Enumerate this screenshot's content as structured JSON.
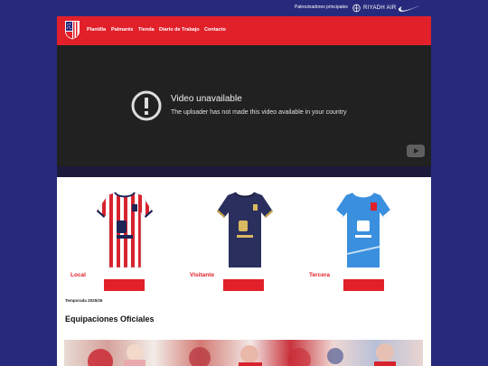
{
  "sponsors": {
    "label": "Patrocinadores principales",
    "riyadh_air": "RIYADH AIR",
    "icons": [
      "riyadh-air-logo",
      "nike-swoosh"
    ]
  },
  "nav": {
    "items": [
      "Plantilla",
      "Palmarés",
      "Tienda",
      "Diario de Trabajo",
      "Contacto"
    ]
  },
  "video": {
    "title": "Video unavailable",
    "message": "The uploader has not made this video available in your country"
  },
  "kits": [
    {
      "label": "Local"
    },
    {
      "label": "Visitante"
    },
    {
      "label": "Tercera"
    }
  ],
  "season": "Temporada 2025/26",
  "section_title": "Equipaciones Oficiales",
  "colors": {
    "background": "#272a7c",
    "brand_red": "#e1202a",
    "video_bg": "#212121",
    "home_white": "#ffffff",
    "away_navy": "#2b2f5e",
    "third_blue": "#3a8fde"
  }
}
